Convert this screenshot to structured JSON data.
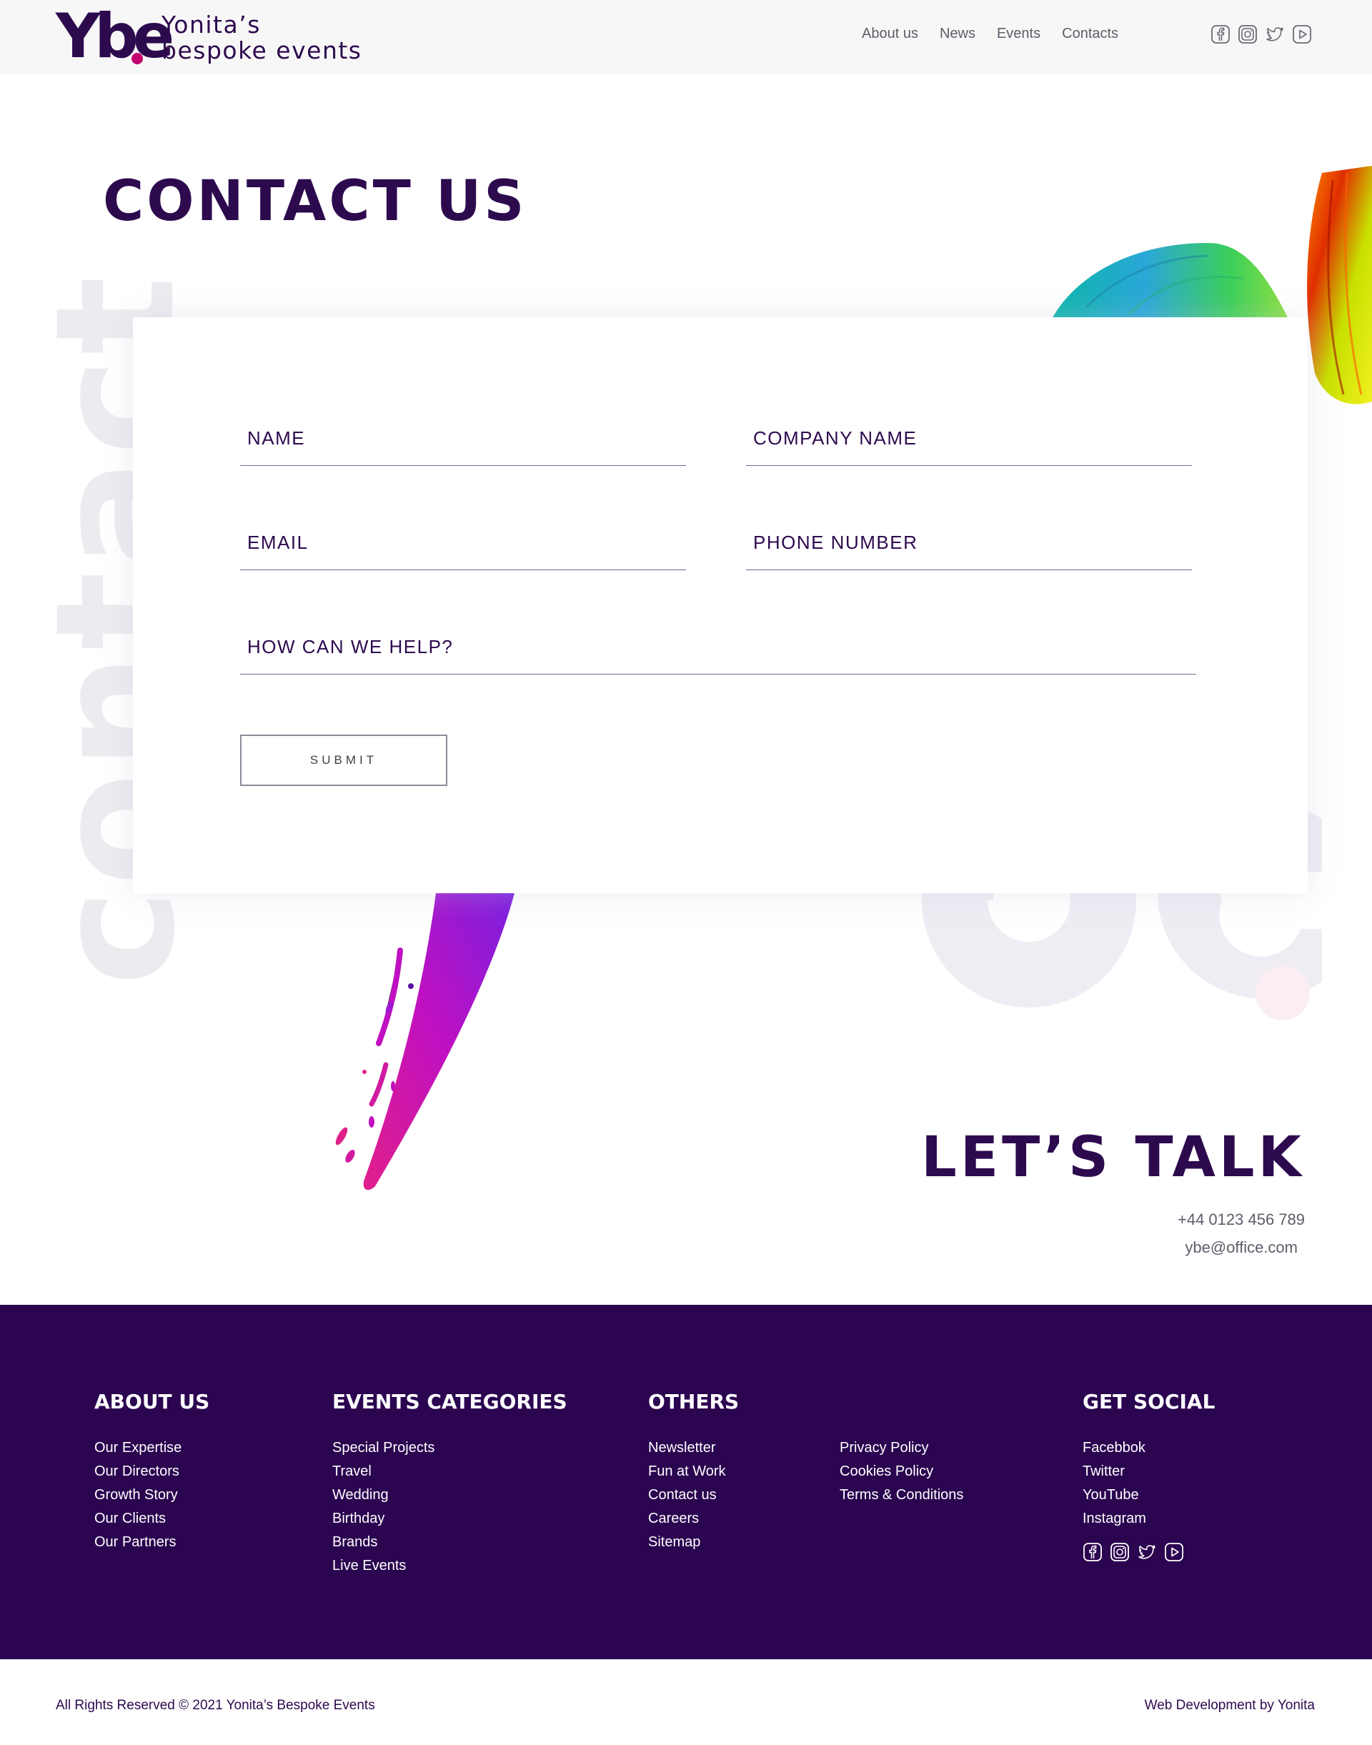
{
  "brand": {
    "logo_mark": "Ybe",
    "name_line1": "Yonita’s",
    "name_line2": "bespoke events",
    "accent": "#c5006f",
    "primary": "#2d0a4e"
  },
  "nav": {
    "items": [
      "About us",
      "News",
      "Events",
      "Contacts"
    ]
  },
  "social_icons": [
    "facebook-icon",
    "instagram-icon",
    "twitter-icon",
    "youtube-icon"
  ],
  "page": {
    "title": "CONTACT US",
    "background_word": "contact"
  },
  "form": {
    "name_label": "NAME",
    "company_label": "COMPANY NAME",
    "email_label": "EMAIL",
    "phone_label": "PHONE NUMBER",
    "help_label": "HOW CAN WE HELP?",
    "submit_label": "SUBMIT"
  },
  "talk": {
    "title": "LET’S TALK",
    "phone": "+44 0123 456 789",
    "email": "ybe@office.com"
  },
  "footer": {
    "about": {
      "title": "ABOUT US",
      "items": [
        "Our Expertise",
        "Our Directors",
        "Growth Story",
        "Our Clients",
        "Our Partners"
      ]
    },
    "categories": {
      "title": "EVENTS CATEGORIES",
      "items": [
        "Special Projects",
        "Travel",
        "Wedding",
        "Birthday",
        "Brands",
        "Live Events"
      ]
    },
    "others": {
      "title": "OTHERS",
      "items_left": [
        "Newsletter",
        "Fun at Work",
        "Contact us",
        "Careers",
        "Sitemap"
      ],
      "items_right": [
        "Privacy Policy",
        "Cookies Policy",
        "Terms & Conditions"
      ]
    },
    "social": {
      "title": "GET SOCIAL",
      "items": [
        "Facebbok",
        "Twitter",
        "YouTube",
        "Instagram"
      ]
    }
  },
  "bottom": {
    "copyright": "All Rights Reserved © 2021 Yonita’s Bespoke Events",
    "credit": "Web Development by Yonita"
  }
}
